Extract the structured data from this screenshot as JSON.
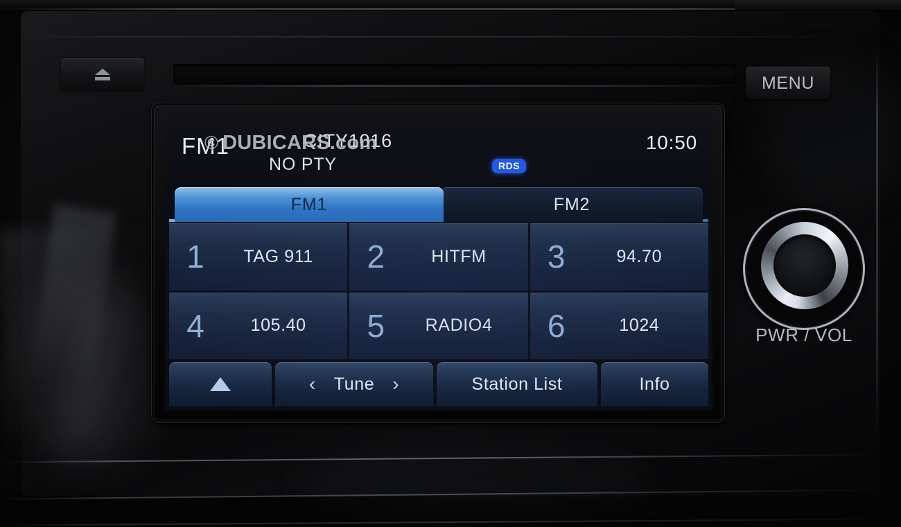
{
  "head_unit": {
    "eject_icon": "eject-icon",
    "menu_button": "MENU",
    "knob_label": "PWR / VOL",
    "cd_slot": "cd-slot"
  },
  "screen": {
    "header": {
      "band": "FM1",
      "station_name": "CITY1016",
      "program_type": "NO PTY",
      "rds_badge": "RDS",
      "clock": "10:50"
    },
    "tabs": [
      {
        "label": "FM1",
        "active": true
      },
      {
        "label": "FM2",
        "active": false
      }
    ],
    "presets": [
      {
        "number": "1",
        "name": "TAG 911"
      },
      {
        "number": "2",
        "name": "HITFM"
      },
      {
        "number": "3",
        "name": "94.70"
      },
      {
        "number": "4",
        "name": "105.40"
      },
      {
        "number": "5",
        "name": "RADIO4"
      },
      {
        "number": "6",
        "name": "1024"
      }
    ],
    "softkeys": {
      "up_arrow": "up-arrow-icon",
      "tune_prev": "‹",
      "tune": "Tune",
      "tune_next": "›",
      "station_list": "Station List",
      "info": "Info"
    }
  },
  "watermark": {
    "copyright": "©",
    "text": "DUBICARS.com"
  },
  "colors": {
    "accent_blue": "#2358e8",
    "tab_active_top": "#8fc0ea",
    "lcd_background": "#0b0d14",
    "preset_text": "#e6ecf7",
    "preset_number": "#9dbde4"
  }
}
